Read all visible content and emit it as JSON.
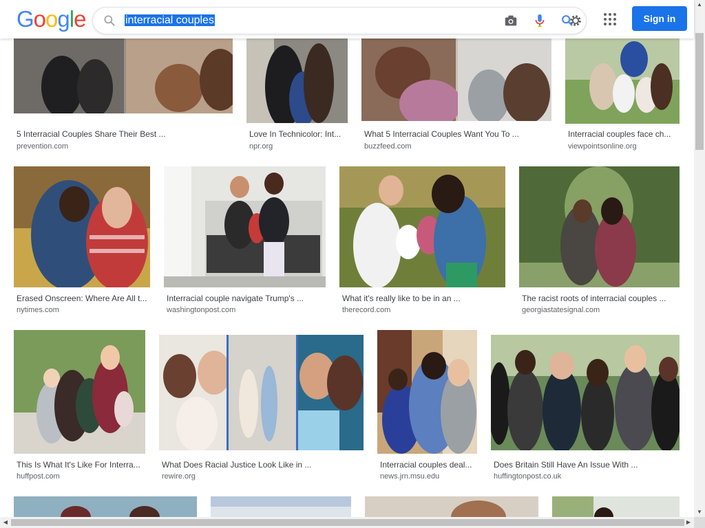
{
  "header": {
    "logo": [
      "G",
      "o",
      "o",
      "g",
      "l",
      "e"
    ],
    "search_query": "interracial couples",
    "signin_label": "Sign in",
    "icons": [
      "search-icon",
      "camera-icon",
      "microphone-icon",
      "lens-icon",
      "settings-icon",
      "apps-grid-icon"
    ]
  },
  "colors": {
    "logo": [
      "#4285F4",
      "#EA4335",
      "#FBBC05",
      "#4285F4",
      "#34A853",
      "#EA4335"
    ],
    "accent": "#1a73e8"
  },
  "results": {
    "row1": [
      {
        "title": "5 Interracial Couples Share Their Best ...",
        "domain": "prevention.com"
      },
      {
        "title": "Love In Technicolor: Int...",
        "domain": "npr.org"
      },
      {
        "title": "What 5 Interracial Couples Want You To ...",
        "domain": "buzzfeed.com"
      },
      {
        "title": "Interracial couples face ch...",
        "domain": "viewpointsonline.org"
      }
    ],
    "row2": [
      {
        "title": "Erased Onscreen: Where Are All t...",
        "domain": "nytimes.com"
      },
      {
        "title": "Interracial couple navigate Trump's ...",
        "domain": "washingtonpost.com"
      },
      {
        "title": "What it's really like to be in an ...",
        "domain": "therecord.com"
      },
      {
        "title": "The racist roots of interracial couples ...",
        "domain": "georgiastatesignal.com"
      }
    ],
    "row3": [
      {
        "title": "This Is What It's Like For Interra...",
        "domain": "huffpost.com"
      },
      {
        "title": "What Does Racial Justice Look Like in ...",
        "domain": "rewire.org"
      },
      {
        "title": "Interracial couples deal...",
        "domain": "news.jrn.msu.edu"
      },
      {
        "title": "Does Britain Still Have An Issue With ...",
        "domain": "huffingtonpost.co.uk"
      }
    ]
  }
}
